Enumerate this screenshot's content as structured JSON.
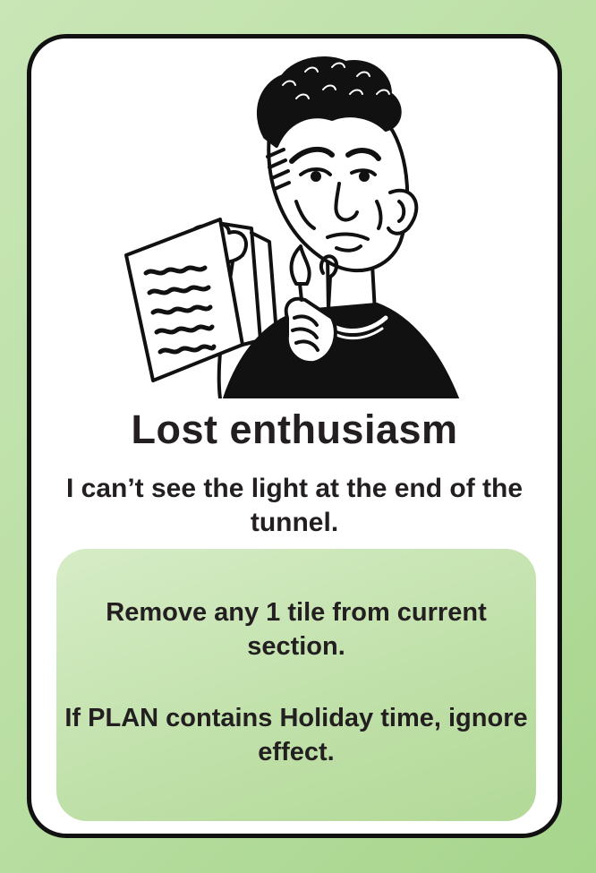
{
  "card": {
    "title": "Lost enthusiasm",
    "flavor_text": "I can’t see the light at the end of the tunnel.",
    "effect": {
      "line1": "Remove any 1 tile from current section.",
      "line2": "If PLAN contains Holiday time, ignore effect."
    },
    "illustration_icon": "dejected-man-holding-paper-icon"
  },
  "colors": {
    "background": "#b9dea2",
    "card": "#ffffff",
    "border": "#111111",
    "effect_box": "#c5e4b0",
    "text": "#231f20"
  }
}
